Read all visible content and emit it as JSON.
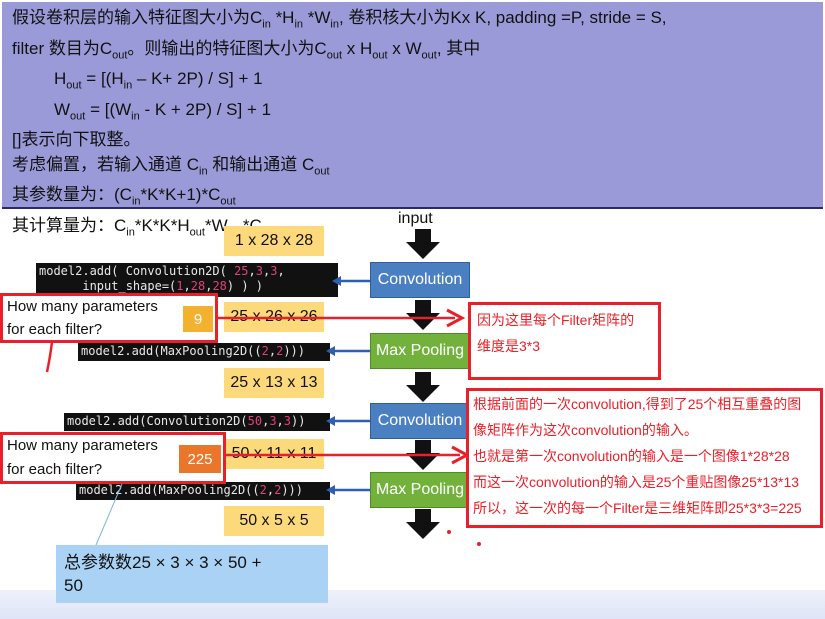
{
  "info": {
    "line1_a": "假设卷积层的输入特征图大小为C",
    "line1_in": "in",
    "line1_b": " *H",
    "line1_in2": "in",
    "line1_c": " *W",
    "line1_in3": "in",
    "line1_d": ", 卷积核大小为Kx K, padding =P, stride = S,",
    "line2_a": "filter 数目为C",
    "line2_out": "out",
    "line2_b": "。则输出的特征图大小为C",
    "line2_out2": "out",
    "line2_c": " x H",
    "line2_out3": "out",
    "line2_d": " x W",
    "line2_out4": "out",
    "line2_e": ", 其中",
    "line3_a": "H",
    "line3_out": "out",
    "line3_b": " = [(H",
    "line3_in": "in",
    "line3_c": " – K+ 2P) / S] + 1",
    "line4_a": "W",
    "line4_out": "out",
    "line4_b": " = [(W",
    "line4_in": "in",
    "line4_c": " - K + 2P) / S] + 1",
    "line5": "[]表示向下取整。",
    "line6_a": "考虑偏置，若输入通道 C",
    "line6_in": "in",
    "line6_b": " 和输出通道 C",
    "line6_out": "out",
    "line7_a": "其参数量为：(C",
    "line7_in": "in",
    "line7_b": "*K*K+1)*C",
    "line7_out": "out",
    "line8_a": "其计算量为：C",
    "line8_in": "in",
    "line8_b": "*K*K*H",
    "line8_out": "out",
    "line8_c": "*W",
    "line8_out2": "out",
    "line8_d": "*C",
    "line8_out3": "out"
  },
  "flow": {
    "input_label": "input",
    "shape1": "1 x 28 x 28",
    "shape2": "25 x 26 x 26",
    "shape3": "25 x 13 x 13",
    "shape4": "50 x 11 x 11",
    "shape5": "50 x 5 x 5",
    "conv_label": "Convolution",
    "pool_label": "Max Pooling"
  },
  "code": {
    "line1_a": "model2.add( Convolution2D( ",
    "line1_n1": "25",
    "line1_b": ",",
    "line1_n2": "3",
    "line1_c": ",",
    "line1_n3": "3",
    "line1_d": ",",
    "line2_a": "      input_shape=(",
    "line2_n1": "1",
    "line2_b": ",",
    "line2_n2": "28",
    "line2_c": ",",
    "line2_n3": "28",
    "line2_d": ") ) )",
    "pool1_a": "model2.add(MaxPooling2D((",
    "pool1_n1": "2",
    "pool1_b": ",",
    "pool1_n2": "2",
    "pool1_c": ")))",
    "conv2_a": "model2.add(Convolution2D(",
    "conv2_n1": "50",
    "conv2_b": ",",
    "conv2_n2": "3",
    "conv2_c": ",",
    "conv2_n3": "3",
    "conv2_d": "))",
    "pool2_a": "model2.add(MaxPooling2D((",
    "pool2_n1": "2",
    "pool2_b": ",",
    "pool2_n2": "2",
    "pool2_c": ")))"
  },
  "questions": {
    "q1_line1": "How many parameters",
    "q1_line2": "for each filter?",
    "q1_answer": "9",
    "q2_line1": "How many parameters",
    "q2_line2": "for each filter?",
    "q2_answer": "225"
  },
  "notes": {
    "note1_line1": "因为这里每个Filter矩阵的",
    "note1_line2": "维度是3*3",
    "note2_line1": "根据前面的一次convolution,得到了25个相互重叠的图",
    "note2_line2": "像矩阵作为这次convolution的输入。",
    "note2_line3": "也就是第一次convolution的输入是一个图像1*28*28",
    "note2_line4": "而这一次convolution的输入是25个重贴图像25*13*13",
    "note2_line5": "所以，这一次的每一个Filter是三维矩阵即25*3*3=225"
  },
  "total": {
    "line1": "总参数数25 × 3 × 3 × 50 +",
    "line2": "50"
  },
  "colors": {
    "panel": "#9a9ad8",
    "yellow": "#fcd97a",
    "conv_blue": "#4a7fc1",
    "pool_green": "#72b23c",
    "red": "#e8202a",
    "badge1": "#f2b230",
    "badge2": "#e9762b"
  }
}
